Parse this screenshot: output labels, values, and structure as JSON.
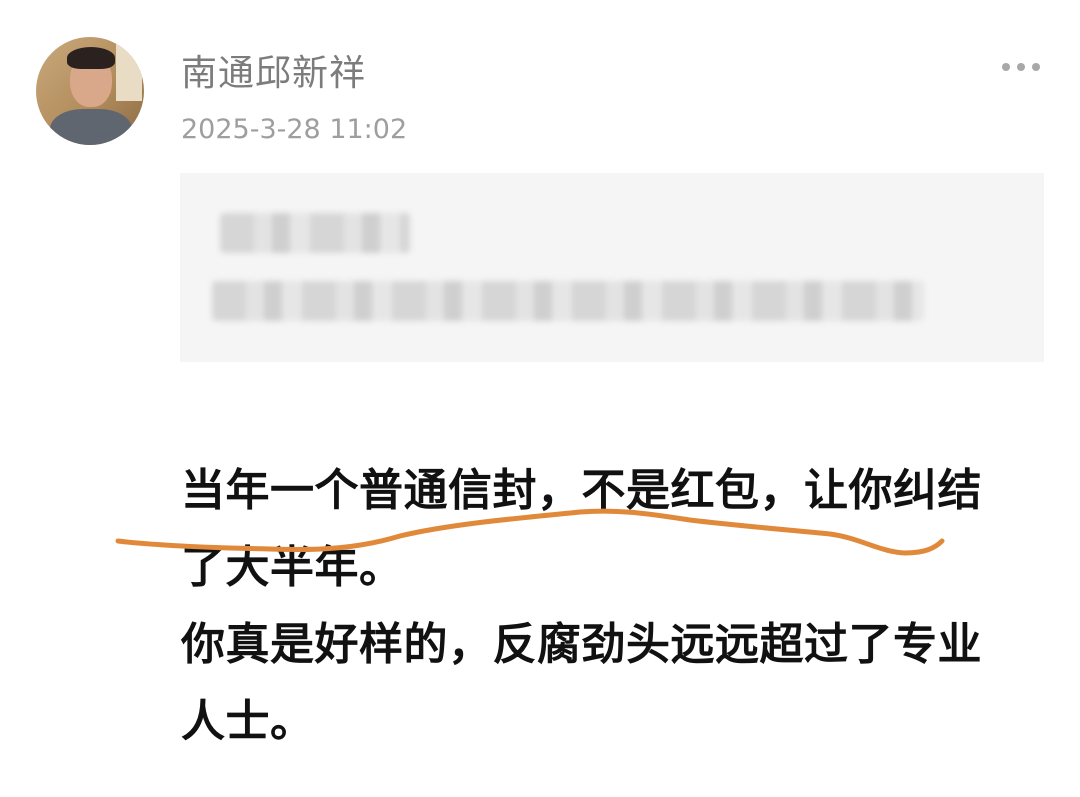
{
  "post": {
    "author_name": "南通邱新祥",
    "timestamp": "2025-3-28 11:02",
    "more_icon": "ellipsis-icon",
    "quoted_block": {
      "obscured": true
    },
    "content_lines": [
      "当年一个普通信封，不是红包，让你纠结",
      "了大半年。",
      "你真是好样的，反腐劲头远远超过了专业",
      "人士。"
    ]
  },
  "annotation": {
    "type": "handwritten-underline",
    "color": "#e0893a"
  }
}
